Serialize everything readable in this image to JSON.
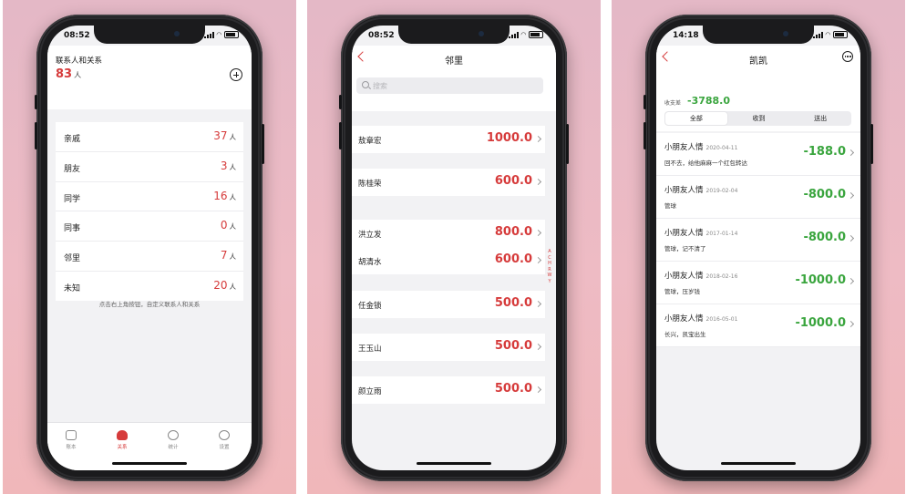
{
  "colors": {
    "accent_red": "#d63b3b",
    "accent_green": "#3aa53e"
  },
  "phone1": {
    "time": "08:52",
    "title": "联系人和关系",
    "count": "83",
    "count_unit": "人",
    "groups": [
      {
        "label": "亲戚",
        "value": "37",
        "unit": "人"
      },
      {
        "label": "朋友",
        "value": "3",
        "unit": "人"
      },
      {
        "label": "同学",
        "value": "16",
        "unit": "人"
      },
      {
        "label": "同事",
        "value": "0",
        "unit": "人"
      },
      {
        "label": "邻里",
        "value": "7",
        "unit": "人"
      },
      {
        "label": "未知",
        "value": "20",
        "unit": "人"
      }
    ],
    "hint": "点击右上角按钮，自定义联系人和关系",
    "tabs": [
      {
        "label": "账本",
        "icon": "wallet-icon"
      },
      {
        "label": "关系",
        "icon": "contacts-icon"
      },
      {
        "label": "统计",
        "icon": "chart-icon"
      },
      {
        "label": "设置",
        "icon": "gear-icon"
      }
    ]
  },
  "phone2": {
    "time": "08:52",
    "title": "邻里",
    "search_placeholder": "搜索",
    "rows": [
      {
        "name": "敖章宏",
        "amount": "1000.0"
      },
      {
        "name": "陈桂荣",
        "amount": "600.0"
      },
      {
        "name": "洪立发",
        "amount": "800.0"
      },
      {
        "name": "胡清水",
        "amount": "600.0"
      },
      {
        "name": "任金锁",
        "amount": "500.0"
      },
      {
        "name": "王玉山",
        "amount": "500.0"
      },
      {
        "name": "颜立雨",
        "amount": "500.0"
      }
    ],
    "index_letters": [
      "A",
      "C",
      "H",
      "R",
      "W",
      "Y"
    ]
  },
  "phone3": {
    "time": "14:18",
    "title": "凯凯",
    "balance_label": "收支差",
    "balance_value": "-3788.0",
    "segments": [
      "全部",
      "收到",
      "送出"
    ],
    "records": [
      {
        "name": "小朋友人情",
        "date": "2020-04-11",
        "note": "回不去，给他麻麻一个红包转达",
        "amount": "-188.0"
      },
      {
        "name": "小朋友人情",
        "date": "2019-02-04",
        "note": "管球",
        "amount": "-800.0"
      },
      {
        "name": "小朋友人情",
        "date": "2017-01-14",
        "note": "管球，记不清了",
        "amount": "-800.0"
      },
      {
        "name": "小朋友人情",
        "date": "2018-02-16",
        "note": "管球，压岁钱",
        "amount": "-1000.0"
      },
      {
        "name": "小朋友人情",
        "date": "2016-05-01",
        "note": "长兴，凯宝出生",
        "amount": "-1000.0"
      }
    ]
  }
}
